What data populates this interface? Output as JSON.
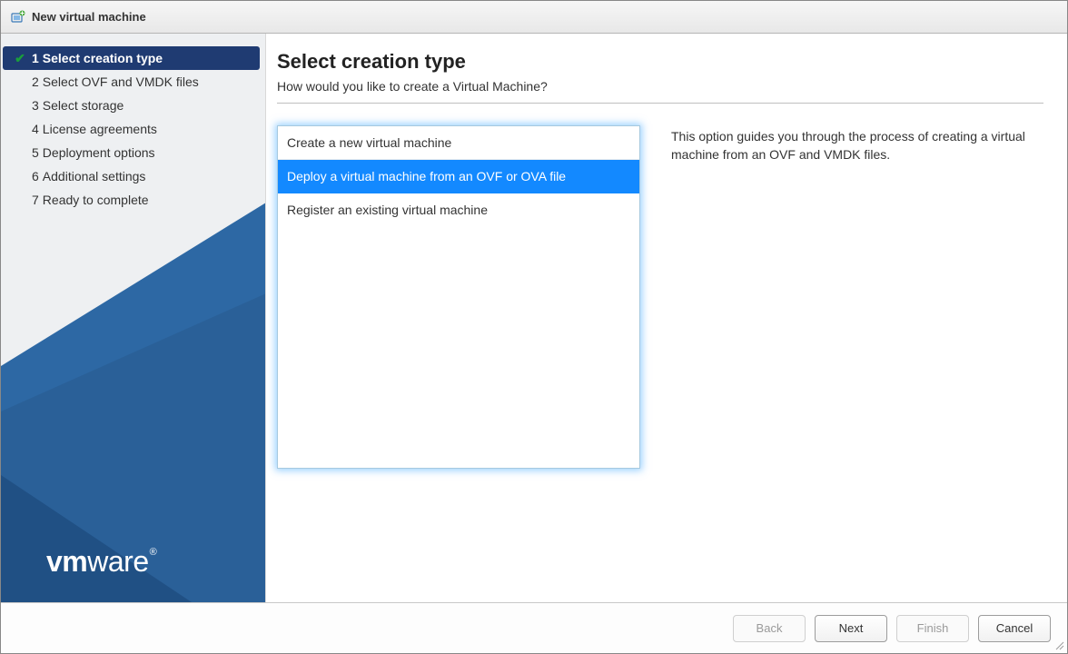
{
  "window": {
    "title": "New virtual machine",
    "icon": "vm-add-icon"
  },
  "sidebar": {
    "steps": [
      {
        "num": "1",
        "label": "Select creation type",
        "active": true
      },
      {
        "num": "2",
        "label": "Select OVF and VMDK files",
        "active": false
      },
      {
        "num": "3",
        "label": "Select storage",
        "active": false
      },
      {
        "num": "4",
        "label": "License agreements",
        "active": false
      },
      {
        "num": "5",
        "label": "Deployment options",
        "active": false
      },
      {
        "num": "6",
        "label": "Additional settings",
        "active": false
      },
      {
        "num": "7",
        "label": "Ready to complete",
        "active": false
      }
    ],
    "brand": "vmware"
  },
  "main": {
    "heading": "Select creation type",
    "subheading": "How would you like to create a Virtual Machine?",
    "options": [
      {
        "label": "Create a new virtual machine",
        "selected": false
      },
      {
        "label": "Deploy a virtual machine from an OVF or OVA file",
        "selected": true
      },
      {
        "label": "Register an existing virtual machine",
        "selected": false
      }
    ],
    "description": "This option guides you through the process of creating a virtual machine from an OVF and VMDK files."
  },
  "footer": {
    "back": "Back",
    "next": "Next",
    "finish": "Finish",
    "cancel": "Cancel",
    "back_disabled": true,
    "finish_disabled": true
  }
}
